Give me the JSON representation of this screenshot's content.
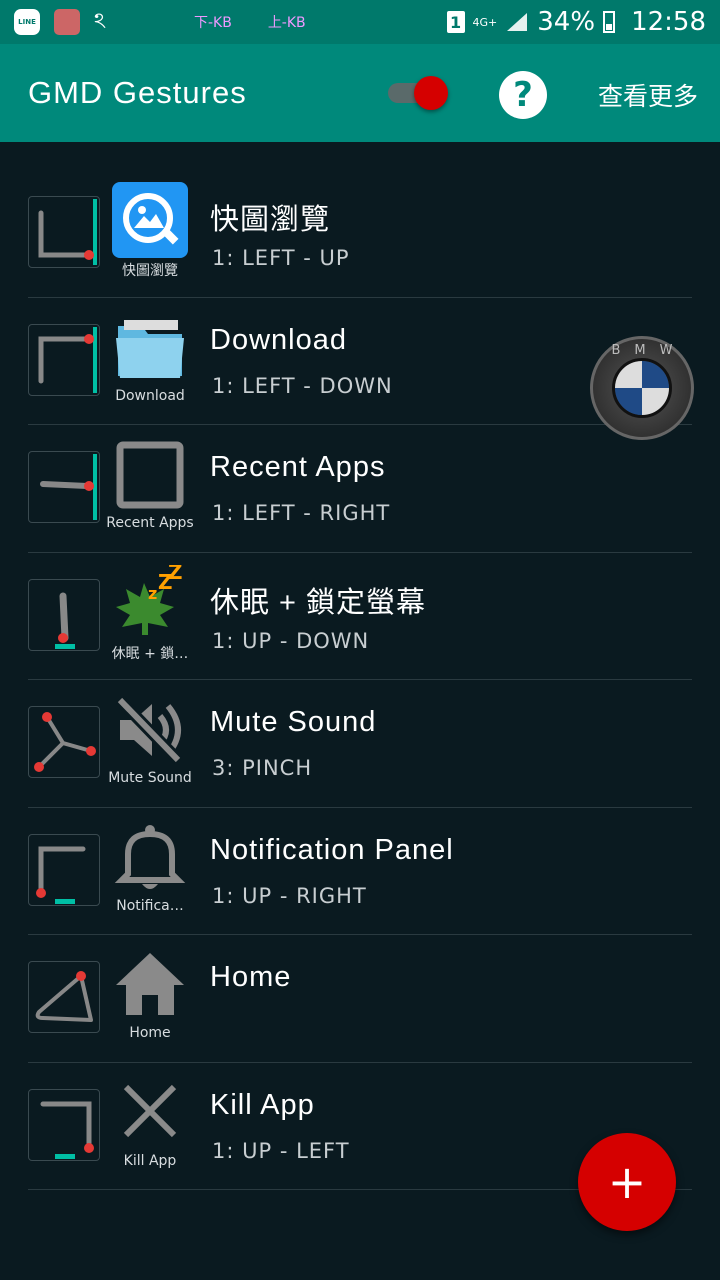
{
  "status": {
    "line_label": "LINE",
    "net_down": "下-KB",
    "net_up": "上-KB",
    "sim": "1",
    "network": "4G+",
    "battery": "34%",
    "time": "12:58"
  },
  "appbar": {
    "title": "GMD Gestures",
    "toggle_on": true,
    "help_label": "?",
    "more_label": "查看更多"
  },
  "gestures": [
    {
      "name": "快圖瀏覽",
      "icon_label": "快圖瀏覽",
      "gesture": "1: LEFT - UP",
      "icon": "gallery-icon",
      "pattern": "left-up"
    },
    {
      "name": "Download",
      "icon_label": "Download",
      "gesture": "1: LEFT - DOWN",
      "icon": "folder-icon",
      "pattern": "left-down"
    },
    {
      "name": "Recent Apps",
      "icon_label": "Recent Apps",
      "gesture": "1: LEFT - RIGHT",
      "icon": "recent-apps-icon",
      "pattern": "left-right"
    },
    {
      "name": "休眠 + 鎖定螢幕",
      "icon_label": "休眠 + 鎖…",
      "gesture": "1: UP - DOWN",
      "icon": "sleep-icon",
      "pattern": "up-down"
    },
    {
      "name": "Mute Sound",
      "icon_label": "Mute Sound",
      "gesture": "3: PINCH",
      "icon": "mute-icon",
      "pattern": "pinch"
    },
    {
      "name": "Notification Panel",
      "icon_label": "Notifica…",
      "gesture": "1: UP - RIGHT",
      "icon": "bell-icon",
      "pattern": "up-right"
    },
    {
      "name": "Home",
      "icon_label": "Home",
      "gesture": "",
      "icon": "home-icon",
      "pattern": "triangle"
    },
    {
      "name": "Kill App",
      "icon_label": "Kill App",
      "gesture": "1: UP - LEFT",
      "icon": "close-icon",
      "pattern": "up-left"
    }
  ],
  "floating": {
    "bmw_letters": "BMW"
  },
  "fab_label": "+"
}
